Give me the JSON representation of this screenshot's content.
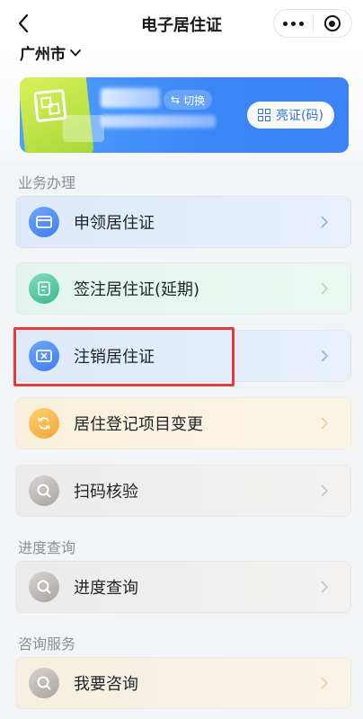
{
  "header": {
    "title": "电子居住证"
  },
  "city": {
    "name": "广州市"
  },
  "card": {
    "switch_label": "切换",
    "show_id_label": "亮证(码)"
  },
  "sections": {
    "business": "业务办理",
    "progress": "进度查询",
    "consult": "咨询服务"
  },
  "rows": {
    "apply": "申领居住证",
    "endorse": "签注居住证(延期)",
    "cancel": "注销居住证",
    "change": "居住登记项目变更",
    "scan": "扫码核验",
    "progress": "进度查询",
    "consult": "我要咨询"
  },
  "colors": {
    "accent_blue": "#3a86f7",
    "highlight_red": "#e43b3b"
  }
}
